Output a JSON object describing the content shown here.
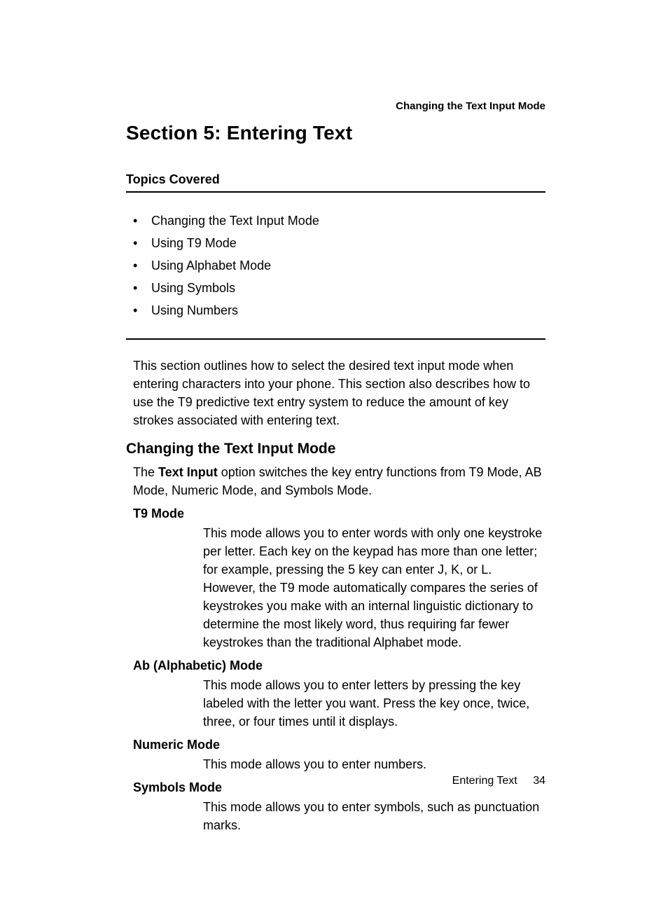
{
  "running_head": "Changing the Text Input Mode",
  "section_title": "Section 5: Entering Text",
  "topics_label": "Topics Covered",
  "topics": [
    "Changing the Text Input Mode",
    "Using T9 Mode",
    "Using Alphabet Mode",
    "Using Symbols",
    "Using Numbers"
  ],
  "intro": "This section outlines how to select the desired text input mode when entering characters into your phone. This section also describes how to use the T9 predictive text entry system to reduce the amount of key strokes associated with entering text.",
  "h2": "Changing the Text Input Mode",
  "change_para_pre": "The ",
  "change_para_bold": "Text Input",
  "change_para_post": " option switches the key entry functions from T9 Mode, AB Mode, Numeric Mode, and Symbols Mode.",
  "modes": {
    "t9": {
      "title": "T9 Mode",
      "body": "This mode allows you to enter words with only one keystroke per letter. Each key on the keypad has more than one letter; for example, pressing the 5 key can enter J, K, or L. However, the T9 mode automatically compares the series of keystrokes you make with an internal linguistic dictionary to determine the most likely word, thus requiring far fewer keystrokes than the traditional Alphabet mode."
    },
    "ab": {
      "title": "Ab (Alphabetic) Mode",
      "body": "This mode allows you to enter letters by pressing the key labeled with the letter you want. Press the key once, twice, three, or four times until it displays."
    },
    "numeric": {
      "title": "Numeric Mode",
      "body": "This mode allows you to enter numbers."
    },
    "symbols": {
      "title": "Symbols Mode",
      "body": "This mode allows you to enter symbols, such as punctuation marks."
    }
  },
  "footer": {
    "label": "Entering Text",
    "page": "34"
  }
}
